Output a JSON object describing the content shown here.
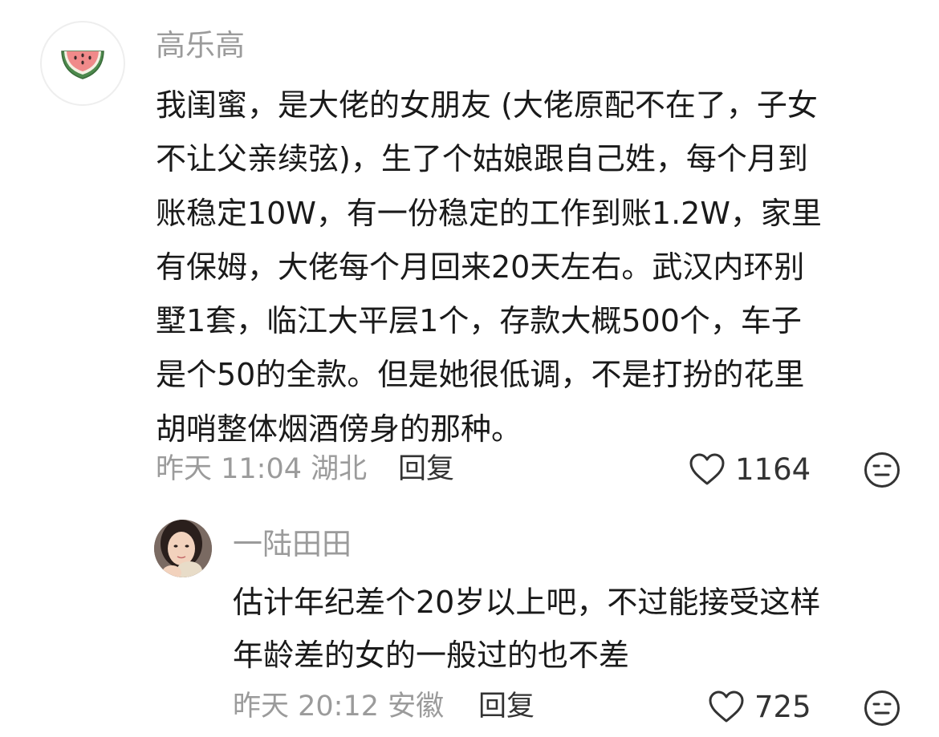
{
  "comment": {
    "avatar_icon": "watermelon-icon",
    "username": "高乐高",
    "text_lines": [
      "我闺蜜，是大佬的女朋友 (大佬原配不在了，子女",
      "不让父亲续弦)，生了个姑娘跟自己姓，每个月到",
      "账稳定10W，有一份稳定的工作到账1.2W，家里",
      "有保姆，大佬每个月回来20天左右。武汉内环别",
      "墅1套，临江大平层1个，存款大概500个，车子",
      "是个50的全款。但是她很低调，不是打扮的花里",
      "胡哨整体烟酒傍身的那种。"
    ],
    "time": "昨天 11:04",
    "location": "湖北",
    "reply_label": "回复",
    "like_icon": "heart-outline-icon",
    "likes": "1164",
    "emoji_icon": "expressionless-face-icon"
  },
  "reply": {
    "avatar_icon": "user-photo-avatar",
    "username": "一陆田田",
    "text_lines": [
      "估计年纪差个20岁以上吧，不过能接受这样",
      "年龄差的女的一般过的也不差"
    ],
    "time": "昨天 20:12",
    "location": "安徽",
    "reply_label": "回复",
    "like_icon": "heart-outline-icon",
    "likes": "725",
    "emoji_icon": "expressionless-face-icon"
  },
  "colors": {
    "text_primary": "#1a1a1a",
    "text_secondary": "#9b9b9b",
    "action_text": "#333333",
    "watermelon_flesh": "#f08a8a",
    "watermelon_rind": "#4d8a4d"
  }
}
